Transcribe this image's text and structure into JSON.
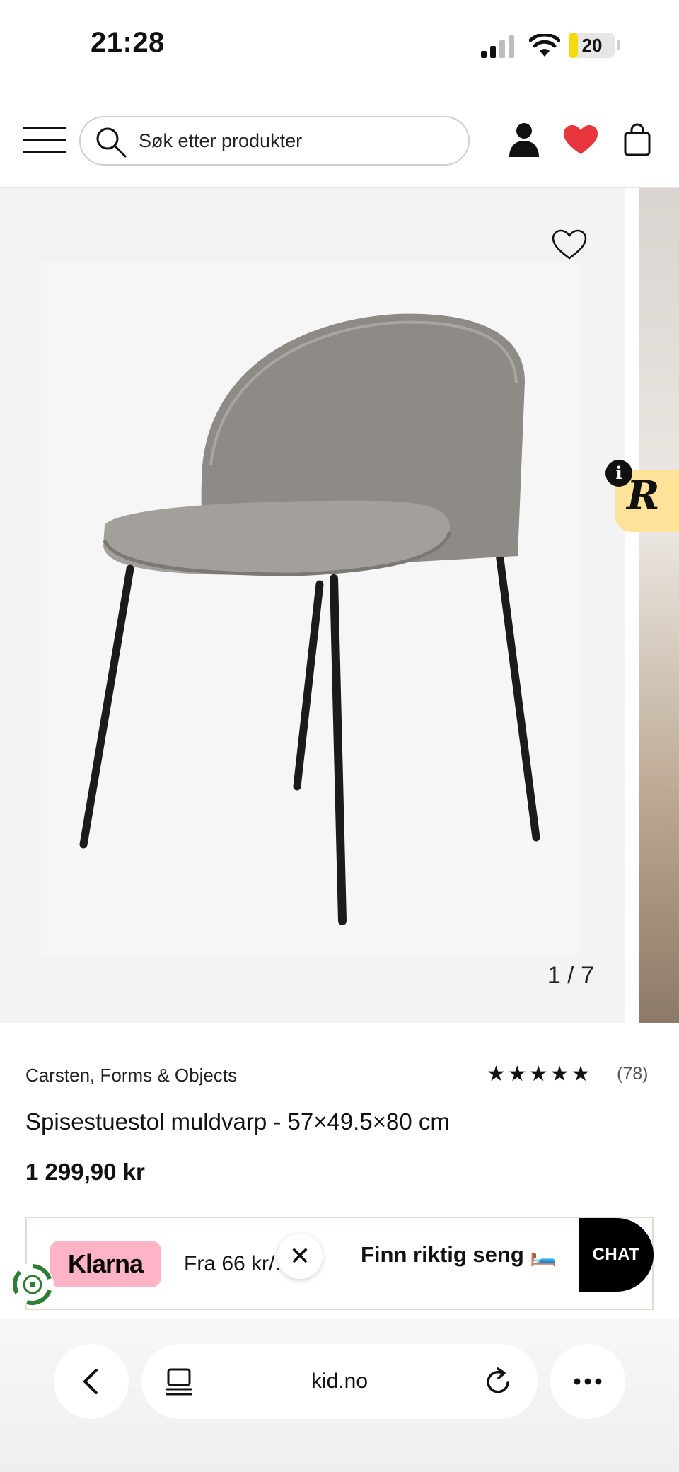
{
  "status_bar": {
    "time": "21:28",
    "battery": "20",
    "battery_level": 0.2,
    "icons": [
      "signal-icon",
      "wifi-icon",
      "battery-icon"
    ]
  },
  "header": {
    "search_placeholder": "Søk etter produkter",
    "icons": [
      "menu-icon",
      "search-icon",
      "account-icon",
      "favorites-heart-icon",
      "cart-icon"
    ],
    "heart_color": "#e8343c"
  },
  "gallery": {
    "counter": "1 / 7",
    "icons": [
      "wishlist-heart-icon",
      "info-icon"
    ],
    "badge_letter": "R",
    "badge_color": "#fde39a"
  },
  "product": {
    "brand": "Carsten, Forms & Objects",
    "rating_stars": 5,
    "stars": "★★★★★",
    "review_count": "(78)",
    "title": "Spisestuestol muldvarp - 57×49.5×80 cm",
    "price": "1 299,90 kr"
  },
  "klarna": {
    "logo": "Klarna",
    "text": "Fra 66 kr/. ne",
    "badge_color": "#ffb3c7"
  },
  "chat_widget": {
    "prompt": "Finn riktig seng 🛏️",
    "chat_label": "CHAT",
    "close_glyph": "✕"
  },
  "browser": {
    "url": "kid.no",
    "icons": [
      "back-icon",
      "tabs-icon",
      "reload-icon",
      "more-icon"
    ]
  }
}
